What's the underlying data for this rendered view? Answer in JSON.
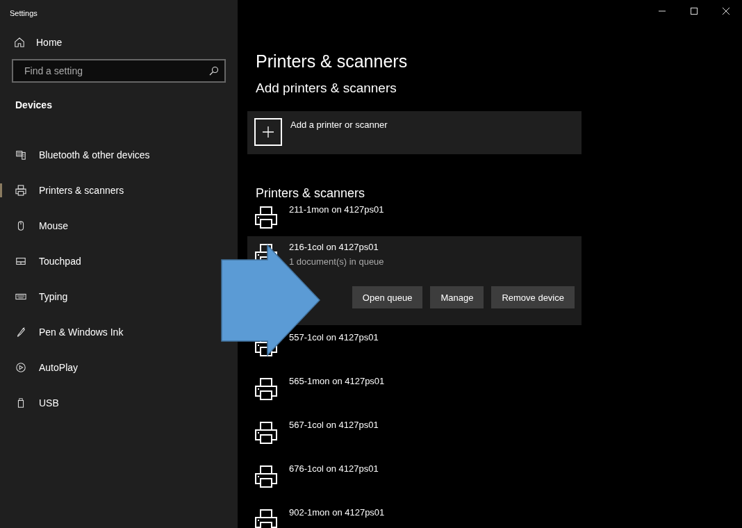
{
  "window": {
    "title": "Settings"
  },
  "sidebar": {
    "home": "Home",
    "search": {
      "placeholder": "Find a setting"
    },
    "section": "Devices",
    "items": [
      {
        "label": "Bluetooth & other devices",
        "selected": false
      },
      {
        "label": "Printers & scanners",
        "selected": true
      },
      {
        "label": "Mouse",
        "selected": false
      },
      {
        "label": "Touchpad",
        "selected": false
      },
      {
        "label": "Typing",
        "selected": false
      },
      {
        "label": "Pen & Windows Ink",
        "selected": false
      },
      {
        "label": "AutoPlay",
        "selected": false
      },
      {
        "label": "USB",
        "selected": false
      }
    ]
  },
  "main": {
    "title": "Printers & scanners",
    "add_heading": "Add printers & scanners",
    "add_button": "Add a printer or scanner",
    "list_heading": "Printers & scanners",
    "printers": [
      {
        "name": "211-1mon on 4127ps01",
        "expanded": false
      },
      {
        "name": "216-1col on 4127ps01",
        "status": "1 document(s) in queue",
        "expanded": true,
        "buttons": [
          "Open queue",
          "Manage",
          "Remove device"
        ]
      },
      {
        "name": "557-1col on 4127ps01",
        "expanded": false
      },
      {
        "name": "565-1mon on 4127ps01",
        "expanded": false
      },
      {
        "name": "567-1col on 4127ps01",
        "expanded": false
      },
      {
        "name": "676-1col on 4127ps01",
        "expanded": false
      },
      {
        "name": "902-1mon on 4127ps01",
        "expanded": false
      }
    ]
  }
}
